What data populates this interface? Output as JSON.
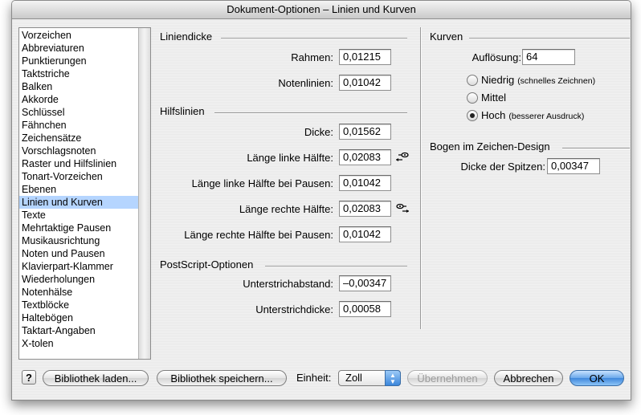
{
  "window": {
    "title": "Dokument-Optionen – Linien und Kurven"
  },
  "sidebar": {
    "items": [
      "Vorzeichen",
      "Abbreviaturen",
      "Punktierungen",
      "Taktstriche",
      "Balken",
      "Akkorde",
      "Schlüssel",
      "Fähnchen",
      "Zeichensätze",
      "Vorschlagsnoten",
      "Raster und Hilfslinien",
      "Tonart-Vorzeichen",
      "Ebenen",
      "Linien und Kurven",
      "Texte",
      "Mehrtaktige Pausen",
      "Musikausrichtung",
      "Noten und Pausen",
      "Klavierpart-Klammer",
      "Wiederholungen",
      "Notenhälse",
      "Textblöcke",
      "Haltebögen",
      "Taktart-Angaben",
      "X-tolen"
    ],
    "selected": "Linien und Kurven"
  },
  "liniendicke": {
    "title": "Liniendicke",
    "rahmen_label": "Rahmen:",
    "rahmen_value": "0,01215",
    "notenlinien_label": "Notenlinien:",
    "notenlinien_value": "0,01042"
  },
  "hilfslinien": {
    "title": "Hilfslinien",
    "dicke_label": "Dicke:",
    "dicke_value": "0,01562",
    "links_label": "Länge linke Hälfte:",
    "links_value": "0,02083",
    "links_pausen_label": "Länge linke Hälfte bei Pausen:",
    "links_pausen_value": "0,01042",
    "rechts_label": "Länge rechte Hälfte:",
    "rechts_value": "0,02083",
    "rechts_pausen_label": "Länge rechte Hälfte bei Pausen:",
    "rechts_pausen_value": "0,01042"
  },
  "postscript": {
    "title": "PostScript-Optionen",
    "abstand_label": "Unterstrichabstand:",
    "abstand_value": "–0,00347",
    "dicke_label": "Unterstrichdicke:",
    "dicke_value": "0,00058"
  },
  "kurven": {
    "title": "Kurven",
    "aufloesung_label": "Auflösung:",
    "aufloesung_value": "64",
    "options": [
      {
        "label": "Niedrig",
        "note": "(schnelles Zeichnen)",
        "checked": false
      },
      {
        "label": "Mittel",
        "note": "",
        "checked": false
      },
      {
        "label": "Hoch",
        "note": "(besserer Ausdruck)",
        "checked": true
      }
    ]
  },
  "bogen": {
    "title": "Bogen im Zeichen-Design",
    "spitzen_label": "Dicke der Spitzen:",
    "spitzen_value": "0,00347"
  },
  "footer": {
    "help": "?",
    "load": "Bibliothek laden...",
    "save": "Bibliothek speichern...",
    "unit_label": "Einheit:",
    "unit_value": "Zoll",
    "apply": "Übernehmen",
    "cancel": "Abbrechen",
    "ok": "OK"
  },
  "colors": {
    "selection": "#b5d5ff",
    "default_button": "#3f88dc"
  },
  "icons": {
    "link": "link-arrows-icon"
  }
}
